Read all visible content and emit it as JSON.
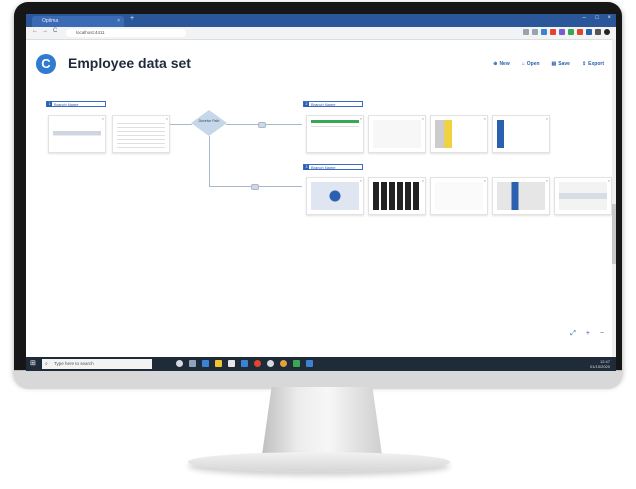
{
  "browser": {
    "tab_title": "Optima",
    "url": "localhost:4411",
    "tab_close": "×",
    "new_tab": "+",
    "window_controls": [
      "–",
      "□",
      "×"
    ],
    "nav": [
      "←",
      "→",
      "C"
    ]
  },
  "app": {
    "logo_letter": "C",
    "title": "Employee data set"
  },
  "toolbar": [
    {
      "icon": "plus-icon",
      "glyph": "⊕",
      "label": "New"
    },
    {
      "icon": "folder-icon",
      "glyph": "⌂",
      "label": "Open"
    },
    {
      "icon": "save-icon",
      "glyph": "▤",
      "label": "Save"
    },
    {
      "icon": "export-icon",
      "glyph": "⇪",
      "label": "Export"
    }
  ],
  "pipeline": {
    "branches": [
      {
        "num": "1",
        "label": "Branch Name"
      },
      {
        "num": "2",
        "label": "Branch Name"
      },
      {
        "num": "3",
        "label": "Branch Name"
      }
    ],
    "decision_label": "Deceive Path"
  },
  "canvas_controls": [
    "⤢",
    "+",
    "−"
  ],
  "taskbar": {
    "search_placeholder": "Type here to search",
    "time": "12:47",
    "date": "01/15/2020"
  },
  "colors": {
    "accent": "#2b5fb0",
    "tabbar": "#2b579a",
    "taskbar": "#202b3a"
  }
}
